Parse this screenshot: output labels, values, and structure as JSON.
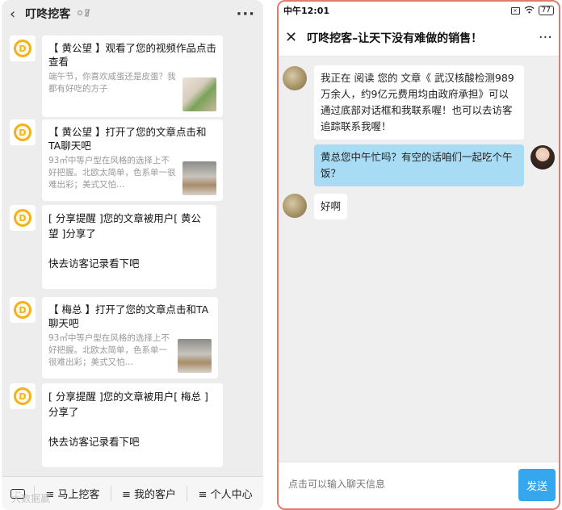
{
  "left": {
    "title": "叮咚挖客",
    "back_icon": "‹",
    "more_icon": "···",
    "messages": [
      {
        "title": "【 黄公望 】观看了您的视频作品点击查看",
        "desc": "端午节，你喜欢咸蛋还是皮蛋？我都有好吃的方子",
        "thumb": "food-thumbnail"
      },
      {
        "title": "【 黄公望 】打开了您的文章点击和TA聊天吧",
        "desc": "93㎡中等户型在风格的选择上不好把握。北欧太简单，色系单一很难出彩；美式又怕…",
        "thumb": "living-room-thumbnail"
      },
      {
        "line1": "[ 分享提醒 ]您的文章被用户[ 黄公",
        "line2": "望 ]分享了",
        "line3": "快去访客记录看下吧"
      },
      {
        "title": "【 梅总 】打开了您的文章点击和TA聊天吧",
        "desc": "93㎡中等户型在风格的选择上不好把握。北欧太简单，色系单一很难出彩；美式又怕…",
        "thumb": "living-room-thumbnail"
      },
      {
        "line1": "[ 分享提醒 ]您的文章被用户[ 梅总 ]",
        "line2": "分享了",
        "line3": "快去访客记录看下吧"
      }
    ],
    "bottom_tabs": [
      "≡ 马上挖客",
      "≡ 我的客户",
      "≡ 个人中心"
    ],
    "watermark": "大数据赢"
  },
  "right": {
    "status_time": "中午12:01",
    "battery": "77",
    "title": "叮咚挖客–让天下没有难做的销售！",
    "chat": [
      {
        "side": "left",
        "text": "我正在 阅读 您的 文章《 武汉核酸检测989万余人，约9亿元费用均由政府承担》可以通过底部对话框和我联系喔！也可以去访客追踪联系我喔！"
      },
      {
        "side": "right",
        "text": "黄总您中午忙吗？有空的话咱们一起吃个午饭？"
      },
      {
        "side": "left",
        "text": "好啊"
      }
    ],
    "input_placeholder": "点击可以输入聊天信息",
    "send_label": "发送"
  },
  "colors": {
    "accent_blue": "#35a7ee",
    "bubble_blue": "#a8dcf5",
    "logo_orange": "#f2b21c"
  }
}
